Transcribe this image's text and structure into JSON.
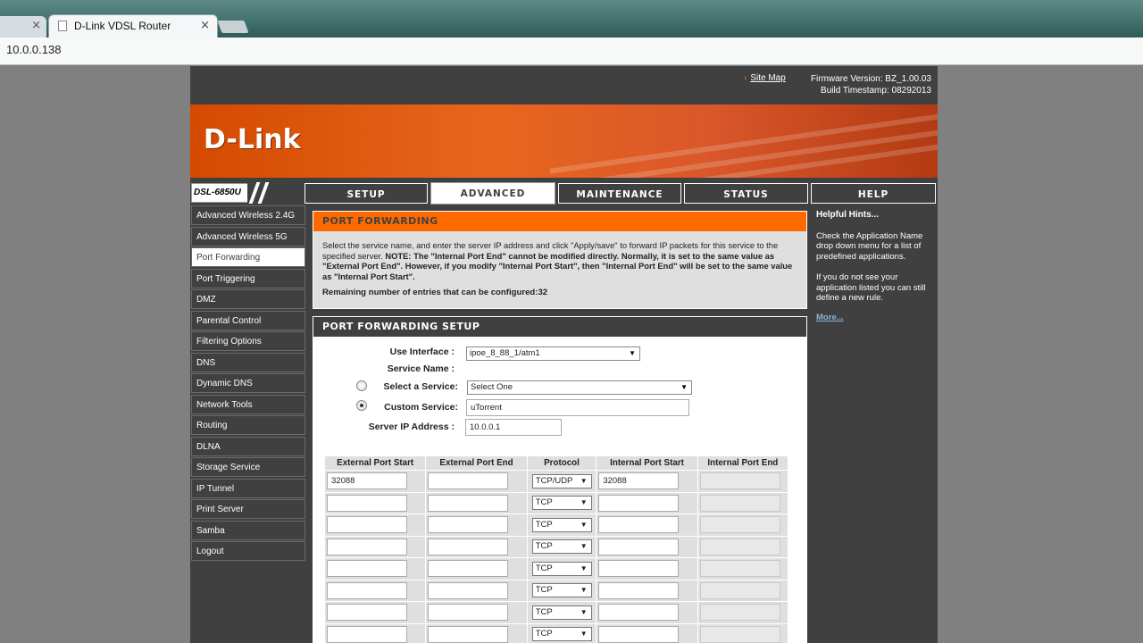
{
  "browser": {
    "tab_title": "D-Link VDSL Router",
    "close_glyph": "×",
    "url": "10.0.0.138"
  },
  "header": {
    "site_map": "Site Map",
    "firmware": "Firmware Version: BZ_1.00.03",
    "build": "Build Timestamp: 08292013",
    "logo": "D-Link",
    "model": "DSL-6850U"
  },
  "nav_tabs": [
    "SETUP",
    "ADVANCED",
    "MAINTENANCE",
    "STATUS",
    "HELP"
  ],
  "sidebar": [
    "Advanced Wireless 2.4G",
    "Advanced Wireless 5G",
    "Port Forwarding",
    "Port Triggering",
    "DMZ",
    "Parental Control",
    "Filtering Options",
    "DNS",
    "Dynamic DNS",
    "Network Tools",
    "Routing",
    "DLNA",
    "Storage Service",
    "IP Tunnel",
    "Print Server",
    "Samba",
    "Logout"
  ],
  "port_forwarding": {
    "title": "PORT FORWARDING",
    "intro": "Select the service name, and enter the server IP address and click \"Apply/save\" to forward IP packets for this service to the specified server.",
    "note": "NOTE: The \"Internal Port End\" cannot be modified directly. Normally, it is set to the same value as \"External Port End\". However, if you modify \"Internal Port Start\", then \"Internal Port End\" will be set to the same value as \"Internal Port Start\".",
    "remaining": "Remaining number of entries that can be configured:32"
  },
  "setup": {
    "title": "PORT FORWARDING SETUP",
    "use_interface_label": "Use Interface :",
    "use_interface_value": "ipoe_8_88_1/atm1",
    "service_name_label": "Service Name :",
    "select_service_label": "Select a Service:",
    "select_service_value": "Select One",
    "custom_service_label": "Custom Service:",
    "custom_service_value": "uTorrent",
    "server_ip_label": "Server IP Address :",
    "server_ip_value": "10.0.0.1",
    "arrow_glyph": "▼"
  },
  "table": {
    "headers": [
      "External Port Start",
      "External Port End",
      "Protocol",
      "Internal Port Start",
      "Internal Port End"
    ],
    "rows": [
      {
        "ext_start": "32088",
        "ext_end": "",
        "protocol": "TCP/UDP",
        "int_start": "32088",
        "int_end": ""
      },
      {
        "ext_start": "",
        "ext_end": "",
        "protocol": "TCP",
        "int_start": "",
        "int_end": ""
      },
      {
        "ext_start": "",
        "ext_end": "",
        "protocol": "TCP",
        "int_start": "",
        "int_end": ""
      },
      {
        "ext_start": "",
        "ext_end": "",
        "protocol": "TCP",
        "int_start": "",
        "int_end": ""
      },
      {
        "ext_start": "",
        "ext_end": "",
        "protocol": "TCP",
        "int_start": "",
        "int_end": ""
      },
      {
        "ext_start": "",
        "ext_end": "",
        "protocol": "TCP",
        "int_start": "",
        "int_end": ""
      },
      {
        "ext_start": "",
        "ext_end": "",
        "protocol": "TCP",
        "int_start": "",
        "int_end": ""
      },
      {
        "ext_start": "",
        "ext_end": "",
        "protocol": "TCP",
        "int_start": "",
        "int_end": ""
      }
    ]
  },
  "hints": {
    "title": "Helpful Hints...",
    "p1": "Check the Application Name drop down menu for a list of predefined applications.",
    "p2": "If you do not see your application listed you can still define a new rule.",
    "more": "More..."
  },
  "colors": {
    "accent": "#ff6a00",
    "dark": "#404040"
  }
}
